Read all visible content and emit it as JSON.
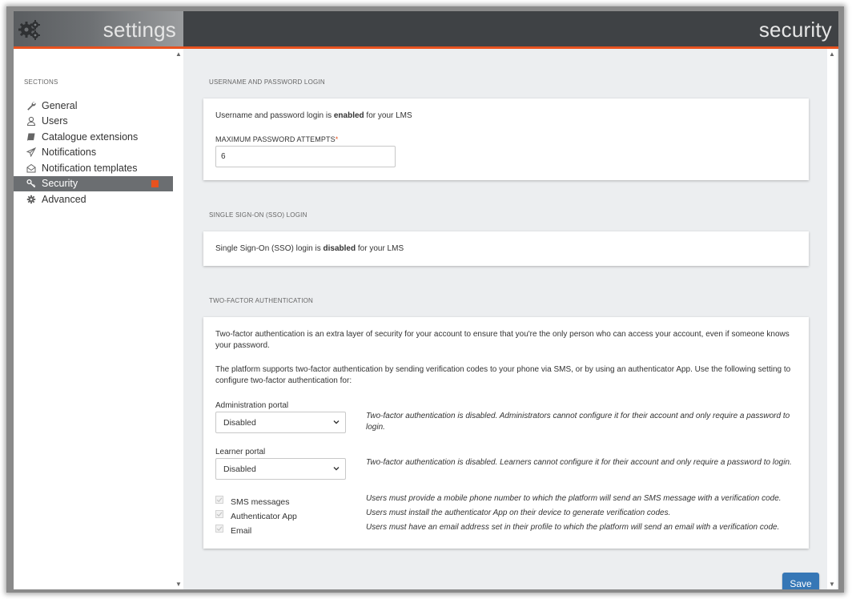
{
  "header": {
    "left_title": "settings",
    "right_title": "security"
  },
  "sidebar": {
    "sections_label": "SECTIONS",
    "items": [
      {
        "label": "General",
        "icon": "wrench-icon"
      },
      {
        "label": "Users",
        "icon": "user-icon"
      },
      {
        "label": "Catalogue extensions",
        "icon": "book-icon"
      },
      {
        "label": "Notifications",
        "icon": "paper-plane-icon"
      },
      {
        "label": "Notification templates",
        "icon": "envelope-open-icon"
      },
      {
        "label": "Security",
        "icon": "key-icon",
        "active": true
      },
      {
        "label": "Advanced",
        "icon": "gear-icon"
      }
    ]
  },
  "password_section": {
    "label": "USERNAME AND PASSWORD LOGIN",
    "status_prefix": "Username and password login is ",
    "status_value": "enabled",
    "status_suffix": " for your LMS",
    "field_label": "MAXIMUM PASSWORD ATTEMPTS",
    "required_mark": "*",
    "field_value": "6"
  },
  "sso_section": {
    "label": "SINGLE SIGN-ON (SSO) LOGIN",
    "status_prefix": "Single Sign-On (SSO) login is ",
    "status_value": "disabled",
    "status_suffix": " for your LMS"
  },
  "tfa_section": {
    "label": "TWO-FACTOR AUTHENTICATION",
    "intro_1": "Two-factor authentication is an extra layer of security for your account to ensure that you're the only person who can access your account, even if someone knows your password.",
    "intro_2": "The platform supports two-factor authentication by sending verification codes to your phone via SMS, or by using an authenticator App. Use the following setting to configure two-factor authentication for:",
    "admin_label": "Administration portal",
    "admin_value": "Disabled",
    "admin_note": "Two-factor authentication is disabled. Administrators cannot configure it for their account and only require a password to login.",
    "learner_label": "Learner portal",
    "learner_value": "Disabled",
    "learner_note": "Two-factor authentication is disabled. Learners cannot configure it for their account and only require a password to login.",
    "methods": [
      {
        "label": "SMS messages",
        "note": "Users must provide a mobile phone number to which the platform will send an SMS message with a verification code.",
        "checked": true
      },
      {
        "label": "Authenticator App",
        "note": "Users must install the authenticator App on their device to generate verification codes.",
        "checked": true
      },
      {
        "label": "Email",
        "note": "Users must have an email address set in their profile to which the platform will send an email with a verification code.",
        "checked": true
      }
    ]
  },
  "actions": {
    "save_label": "Save"
  },
  "colors": {
    "accent": "#e8521f",
    "primary_button": "#3677b6",
    "header_dark": "#3f4245",
    "active_nav": "#6b6e71"
  }
}
